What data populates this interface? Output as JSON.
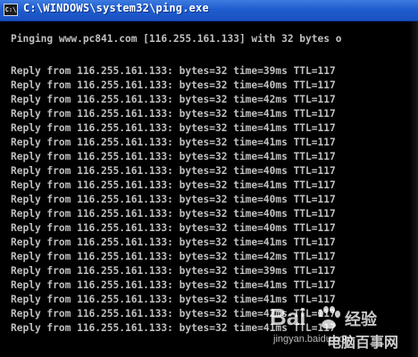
{
  "window": {
    "title": "C:\\WINDOWS\\system32\\ping.exe",
    "icon_label": "C:\\",
    "icon": "console-icon"
  },
  "console": {
    "pinging_line": "Pinging www.pc841.com [116.255.161.133] with 32 bytes o",
    "reply_lines": [
      "Reply from 116.255.161.133: bytes=32 time=39ms TTL=117",
      "Reply from 116.255.161.133: bytes=32 time=40ms TTL=117",
      "Reply from 116.255.161.133: bytes=32 time=42ms TTL=117",
      "Reply from 116.255.161.133: bytes=32 time=41ms TTL=117",
      "Reply from 116.255.161.133: bytes=32 time=41ms TTL=117",
      "Reply from 116.255.161.133: bytes=32 time=41ms TTL=117",
      "Reply from 116.255.161.133: bytes=32 time=41ms TTL=117",
      "Reply from 116.255.161.133: bytes=32 time=40ms TTL=117",
      "Reply from 116.255.161.133: bytes=32 time=41ms TTL=117",
      "Reply from 116.255.161.133: bytes=32 time=40ms TTL=117",
      "Reply from 116.255.161.133: bytes=32 time=40ms TTL=117",
      "Reply from 116.255.161.133: bytes=32 time=40ms TTL=117",
      "Reply from 116.255.161.133: bytes=32 time=41ms TTL=117",
      "Reply from 116.255.161.133: bytes=32 time=42ms TTL=117",
      "Reply from 116.255.161.133: bytes=32 time=39ms TTL=117",
      "Reply from 116.255.161.133: bytes=32 time=41ms TTL=117",
      "Reply from 116.255.161.133: bytes=32 time=41ms TTL=117",
      "Reply from 116.255.161.133: bytes=32 time=42ms TTL=117",
      "Reply from 116.255.161.133: bytes=32 time=41ms TTL=117"
    ]
  },
  "watermark": {
    "logo": "Bai",
    "suffix": "经验",
    "url": "jingyan.baidu.com",
    "site": "电脑百事网"
  },
  "colors": {
    "console_bg": "#000000",
    "console_text": "#c0c0c0",
    "titlebar": "#1f5ccf",
    "title_text": "#ffffff"
  }
}
